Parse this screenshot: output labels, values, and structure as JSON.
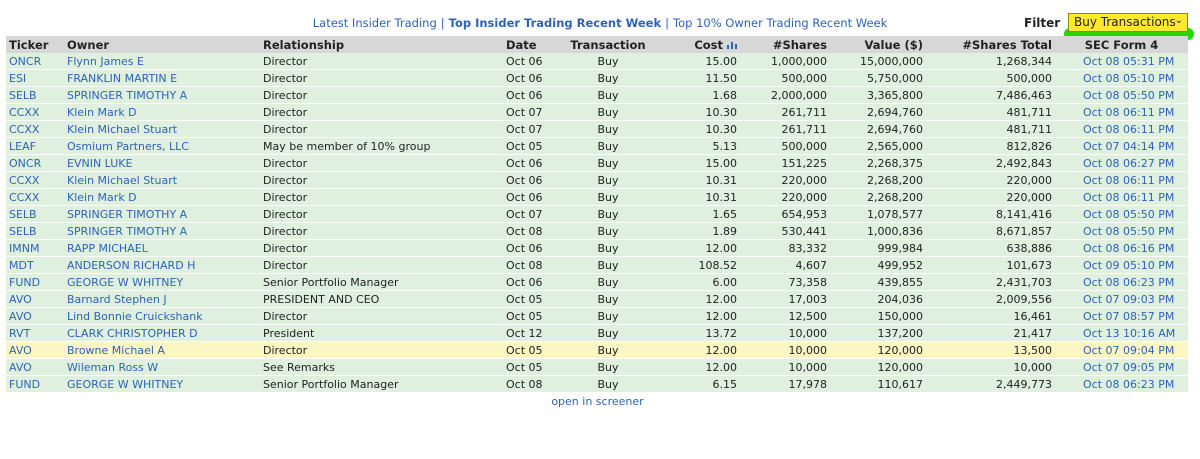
{
  "nav": {
    "links": [
      {
        "label": "Latest Insider Trading"
      },
      {
        "label": "Top Insider Trading Recent Week"
      },
      {
        "label": "Top 10% Owner Trading Recent Week"
      }
    ],
    "separator": "|"
  },
  "filter": {
    "label": "Filter",
    "value": "Buy Transactions"
  },
  "table": {
    "headers": {
      "ticker": "Ticker",
      "owner": "Owner",
      "relationship": "Relationship",
      "date": "Date",
      "transaction": "Transaction",
      "cost": "Cost",
      "shares": "#Shares",
      "value": "Value ($)",
      "shares_total": "#Shares Total",
      "sec_form": "SEC Form 4"
    },
    "rows": [
      {
        "ticker": "ONCR",
        "owner": "Flynn James E",
        "relationship": "Director",
        "date": "Oct 06",
        "transaction": "Buy",
        "cost": "15.00",
        "shares": "1,000,000",
        "value": "15,000,000",
        "shares_total": "1,268,344",
        "sec_form": "Oct 08 05:31 PM"
      },
      {
        "ticker": "ESI",
        "owner": "FRANKLIN MARTIN E",
        "relationship": "Director",
        "date": "Oct 06",
        "transaction": "Buy",
        "cost": "11.50",
        "shares": "500,000",
        "value": "5,750,000",
        "shares_total": "500,000",
        "sec_form": "Oct 08 05:10 PM"
      },
      {
        "ticker": "SELB",
        "owner": "SPRINGER TIMOTHY A",
        "relationship": "Director",
        "date": "Oct 06",
        "transaction": "Buy",
        "cost": "1.68",
        "shares": "2,000,000",
        "value": "3,365,800",
        "shares_total": "7,486,463",
        "sec_form": "Oct 08 05:50 PM"
      },
      {
        "ticker": "CCXX",
        "owner": "Klein Mark D",
        "relationship": "Director",
        "date": "Oct 07",
        "transaction": "Buy",
        "cost": "10.30",
        "shares": "261,711",
        "value": "2,694,760",
        "shares_total": "481,711",
        "sec_form": "Oct 08 06:11 PM"
      },
      {
        "ticker": "CCXX",
        "owner": "Klein Michael Stuart",
        "relationship": "Director",
        "date": "Oct 07",
        "transaction": "Buy",
        "cost": "10.30",
        "shares": "261,711",
        "value": "2,694,760",
        "shares_total": "481,711",
        "sec_form": "Oct 08 06:11 PM"
      },
      {
        "ticker": "LEAF",
        "owner": "Osmium Partners, LLC",
        "relationship": "May be member of 10% group",
        "date": "Oct 05",
        "transaction": "Buy",
        "cost": "5.13",
        "shares": "500,000",
        "value": "2,565,000",
        "shares_total": "812,826",
        "sec_form": "Oct 07 04:14 PM"
      },
      {
        "ticker": "ONCR",
        "owner": "EVNIN LUKE",
        "relationship": "Director",
        "date": "Oct 06",
        "transaction": "Buy",
        "cost": "15.00",
        "shares": "151,225",
        "value": "2,268,375",
        "shares_total": "2,492,843",
        "sec_form": "Oct 08 06:27 PM"
      },
      {
        "ticker": "CCXX",
        "owner": "Klein Michael Stuart",
        "relationship": "Director",
        "date": "Oct 06",
        "transaction": "Buy",
        "cost": "10.31",
        "shares": "220,000",
        "value": "2,268,200",
        "shares_total": "220,000",
        "sec_form": "Oct 08 06:11 PM"
      },
      {
        "ticker": "CCXX",
        "owner": "Klein Mark D",
        "relationship": "Director",
        "date": "Oct 06",
        "transaction": "Buy",
        "cost": "10.31",
        "shares": "220,000",
        "value": "2,268,200",
        "shares_total": "220,000",
        "sec_form": "Oct 08 06:11 PM"
      },
      {
        "ticker": "SELB",
        "owner": "SPRINGER TIMOTHY A",
        "relationship": "Director",
        "date": "Oct 07",
        "transaction": "Buy",
        "cost": "1.65",
        "shares": "654,953",
        "value": "1,078,577",
        "shares_total": "8,141,416",
        "sec_form": "Oct 08 05:50 PM"
      },
      {
        "ticker": "SELB",
        "owner": "SPRINGER TIMOTHY A",
        "relationship": "Director",
        "date": "Oct 08",
        "transaction": "Buy",
        "cost": "1.89",
        "shares": "530,441",
        "value": "1,000,836",
        "shares_total": "8,671,857",
        "sec_form": "Oct 08 05:50 PM"
      },
      {
        "ticker": "IMNM",
        "owner": "RAPP MICHAEL",
        "relationship": "Director",
        "date": "Oct 06",
        "transaction": "Buy",
        "cost": "12.00",
        "shares": "83,332",
        "value": "999,984",
        "shares_total": "638,886",
        "sec_form": "Oct 08 06:16 PM"
      },
      {
        "ticker": "MDT",
        "owner": "ANDERSON RICHARD H",
        "relationship": "Director",
        "date": "Oct 08",
        "transaction": "Buy",
        "cost": "108.52",
        "shares": "4,607",
        "value": "499,952",
        "shares_total": "101,673",
        "sec_form": "Oct 09 05:10 PM"
      },
      {
        "ticker": "FUND",
        "owner": "GEORGE W WHITNEY",
        "relationship": "Senior Portfolio Manager",
        "date": "Oct 06",
        "transaction": "Buy",
        "cost": "6.00",
        "shares": "73,358",
        "value": "439,855",
        "shares_total": "2,431,703",
        "sec_form": "Oct 08 06:23 PM"
      },
      {
        "ticker": "AVO",
        "owner": "Barnard Stephen J",
        "relationship": "PRESIDENT AND CEO",
        "date": "Oct 05",
        "transaction": "Buy",
        "cost": "12.00",
        "shares": "17,003",
        "value": "204,036",
        "shares_total": "2,009,556",
        "sec_form": "Oct 07 09:03 PM"
      },
      {
        "ticker": "AVO",
        "owner": "Lind Bonnie Cruickshank",
        "relationship": "Director",
        "date": "Oct 05",
        "transaction": "Buy",
        "cost": "12.00",
        "shares": "12,500",
        "value": "150,000",
        "shares_total": "16,461",
        "sec_form": "Oct 07 08:57 PM"
      },
      {
        "ticker": "RVT",
        "owner": "CLARK CHRISTOPHER D",
        "relationship": "President",
        "date": "Oct 12",
        "transaction": "Buy",
        "cost": "13.72",
        "shares": "10,000",
        "value": "137,200",
        "shares_total": "21,417",
        "sec_form": "Oct 13 10:16 AM"
      },
      {
        "ticker": "AVO",
        "owner": "Browne Michael A",
        "relationship": "Director",
        "date": "Oct 05",
        "transaction": "Buy",
        "cost": "12.00",
        "shares": "10,000",
        "value": "120,000",
        "shares_total": "13,500",
        "sec_form": "Oct 07 09:04 PM"
      },
      {
        "ticker": "AVO",
        "owner": "Wileman Ross W",
        "relationship": "See Remarks",
        "date": "Oct 05",
        "transaction": "Buy",
        "cost": "12.00",
        "shares": "10,000",
        "value": "120,000",
        "shares_total": "10,000",
        "sec_form": "Oct 07 09:05 PM"
      },
      {
        "ticker": "FUND",
        "owner": "GEORGE W WHITNEY",
        "relationship": "Senior Portfolio Manager",
        "date": "Oct 08",
        "transaction": "Buy",
        "cost": "6.15",
        "shares": "17,978",
        "value": "110,617",
        "shares_total": "2,449,773",
        "sec_form": "Oct 08 06:23 PM"
      }
    ]
  },
  "footer": {
    "screener_link": "open in screener"
  },
  "colors": {
    "row_bg": "#dff0df",
    "highlight_row_bg": "#fcf6c4",
    "link": "#2f63b5",
    "header_bg": "#d7d7d7",
    "filter_bg": "#ffe82f",
    "marker": "#2ad400"
  }
}
